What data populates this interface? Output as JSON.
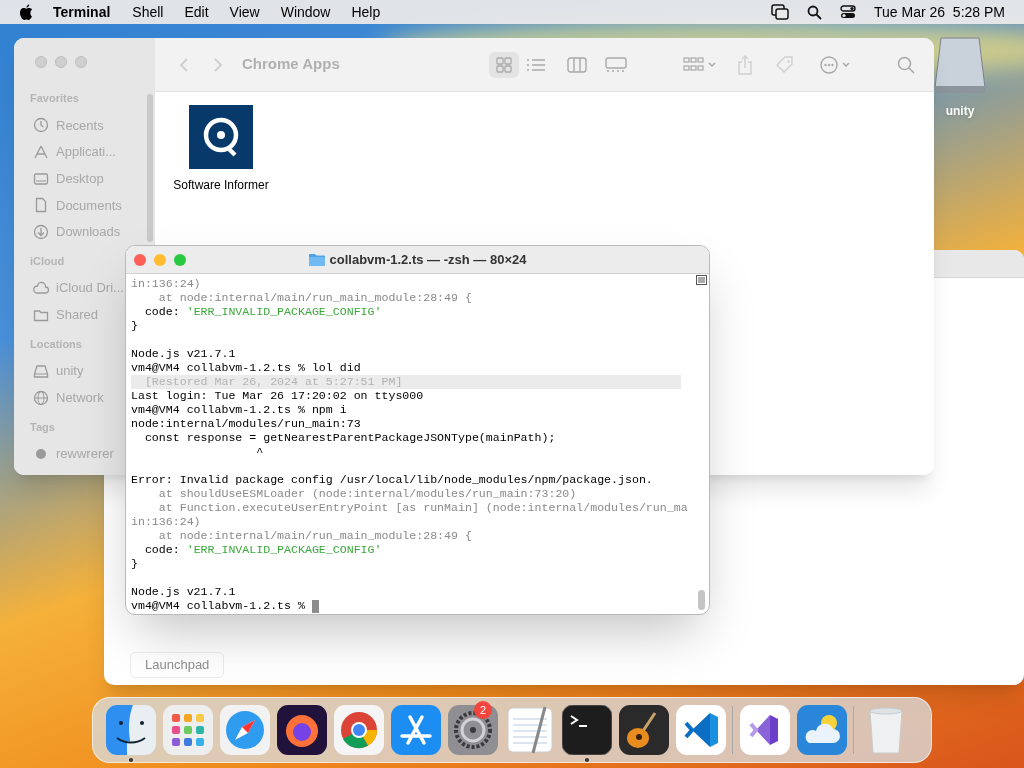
{
  "menu_bar": {
    "app": "Terminal",
    "menus": [
      "Shell",
      "Edit",
      "View",
      "Window",
      "Help"
    ],
    "clock": "Tue Mar 26  5:28 PM"
  },
  "desktop_icons": [
    {
      "label": "unity"
    }
  ],
  "finder": {
    "title": "Chrome Apps",
    "sidebar": [
      {
        "heading": "Favorites",
        "items": [
          {
            "kind": "clock",
            "label": "Recents"
          },
          {
            "kind": "apps",
            "label": "Applicati..."
          },
          {
            "kind": "desktop",
            "label": "Desktop"
          },
          {
            "kind": "doc",
            "label": "Documents"
          },
          {
            "kind": "download",
            "label": "Downloads"
          }
        ]
      },
      {
        "heading": "iCloud",
        "items": [
          {
            "kind": "cloud",
            "label": "iCloud Dri..."
          },
          {
            "kind": "folder",
            "label": "Shared"
          }
        ]
      },
      {
        "heading": "Locations",
        "items": [
          {
            "kind": "drive",
            "label": "unity"
          },
          {
            "kind": "globe",
            "label": "Network"
          }
        ]
      },
      {
        "heading": "Tags",
        "items": [
          {
            "kind": "tag",
            "label": "rewwrerer"
          }
        ]
      }
    ],
    "files": [
      {
        "label": "Software Informer"
      }
    ]
  },
  "back_window": {
    "button": "Launchpad"
  },
  "terminal": {
    "title": "collabvm-1.2.ts — -zsh — 80×24",
    "lines": [
      {
        "kind": "trace",
        "text": "in:136:24)"
      },
      {
        "kind": "trace",
        "text": "    at node:internal/main/run_main_module:28:49 {"
      },
      {
        "kind": "code",
        "text": "  code: ",
        "value": "'ERR_INVALID_PACKAGE_CONFIG'"
      },
      {
        "kind": "plain",
        "text": "}"
      },
      {
        "kind": "blank"
      },
      {
        "kind": "plain",
        "text": "Node.js v21.7.1"
      },
      {
        "kind": "plain",
        "text": "vm4@VM4 collabvm-1.2.ts % lol did"
      },
      {
        "kind": "restored",
        "text": "  [Restored Mar 26, 2024 at 5:27:51 PM]"
      },
      {
        "kind": "plain",
        "text": "Last login: Tue Mar 26 17:20:02 on ttys000"
      },
      {
        "kind": "plain",
        "text": "vm4@VM4 collabvm-1.2.ts % npm i"
      },
      {
        "kind": "plain",
        "text": "node:internal/modules/run_main:73"
      },
      {
        "kind": "plain",
        "text": "  const response = getNearestParentPackageJSONType(mainPath);"
      },
      {
        "kind": "plain",
        "text": "                  ^"
      },
      {
        "kind": "blank"
      },
      {
        "kind": "plain",
        "text": "Error: Invalid package config /usr/local/lib/node_modules/npm/package.json."
      },
      {
        "kind": "trace",
        "text": "    at shouldUseESMLoader (node:internal/modules/run_main:73:20)"
      },
      {
        "kind": "trace",
        "text": "    at Function.executeUserEntryPoint [as runMain] (node:internal/modules/run_ma"
      },
      {
        "kind": "trace",
        "text": "in:136:24)"
      },
      {
        "kind": "trace",
        "text": "    at node:internal/main/run_main_module:28:49 {"
      },
      {
        "kind": "code",
        "text": "  code: ",
        "value": "'ERR_INVALID_PACKAGE_CONFIG'"
      },
      {
        "kind": "plain",
        "text": "}"
      },
      {
        "kind": "blank"
      },
      {
        "kind": "plain",
        "text": "Node.js v21.7.1"
      },
      {
        "kind": "cursor",
        "text": "vm4@VM4 collabvm-1.2.ts % "
      }
    ]
  },
  "dock": [
    {
      "kind": "finder",
      "running": true
    },
    {
      "kind": "launchpad",
      "running": false
    },
    {
      "kind": "safari",
      "running": false
    },
    {
      "kind": "firefox",
      "running": false
    },
    {
      "kind": "chrome",
      "running": false
    },
    {
      "kind": "appstore",
      "running": false
    },
    {
      "kind": "settings",
      "running": false,
      "badge": "2"
    },
    {
      "kind": "textedit",
      "running": false
    },
    {
      "kind": "terminal",
      "running": true
    },
    {
      "kind": "garageband",
      "running": false
    },
    {
      "kind": "vscode",
      "running": false
    },
    {
      "kind": "separator"
    },
    {
      "kind": "visualstudio",
      "running": false
    },
    {
      "kind": "weather",
      "running": false
    },
    {
      "kind": "separator"
    },
    {
      "kind": "trash",
      "running": false
    }
  ]
}
